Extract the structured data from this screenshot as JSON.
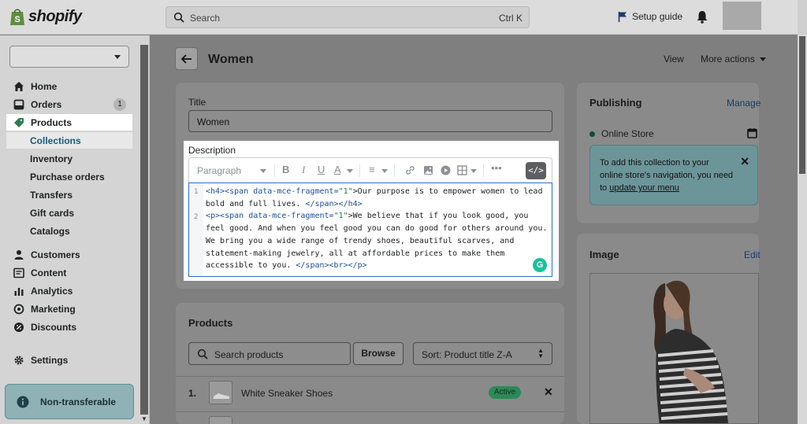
{
  "topbar": {
    "brand": "shopify",
    "search_placeholder": "Search",
    "search_shortcut": "Ctrl K",
    "setup_guide": "Setup guide"
  },
  "sidebar": {
    "store_select_value": "",
    "items": [
      {
        "label": "Home",
        "icon": "home-icon"
      },
      {
        "label": "Orders",
        "icon": "orders-icon",
        "badge": "1"
      },
      {
        "label": "Products",
        "icon": "tag-icon",
        "active": true
      },
      {
        "label": "Collections",
        "sub": true,
        "selected": true
      },
      {
        "label": "Inventory",
        "sub": true
      },
      {
        "label": "Purchase orders",
        "sub": true
      },
      {
        "label": "Transfers",
        "sub": true
      },
      {
        "label": "Gift cards",
        "sub": true
      },
      {
        "label": "Catalogs",
        "sub": true
      },
      {
        "label": "Customers",
        "icon": "person-icon"
      },
      {
        "label": "Content",
        "icon": "content-icon"
      },
      {
        "label": "Analytics",
        "icon": "analytics-icon"
      },
      {
        "label": "Marketing",
        "icon": "marketing-icon"
      },
      {
        "label": "Discounts",
        "icon": "discount-icon"
      },
      {
        "label": "Settings",
        "icon": "gear-icon"
      }
    ],
    "nontransferable": "Non-transferable"
  },
  "page": {
    "title": "Women",
    "view_label": "View",
    "more_actions_label": "More actions"
  },
  "collection_form": {
    "title_label": "Title",
    "title_value": "Women",
    "description_label": "Description",
    "paragraph_label": "Paragraph",
    "code_lines": {
      "l1_tag_open": "<h4><span ",
      "l1_attr": "data-mce-fragment=",
      "l1_val": "\"1\"",
      "l1_text": ">Our purpose is to empower women to lead bold and full lives. ",
      "l1_tag_close": "</span></h4>",
      "l2_tag_open": "<p><span ",
      "l2_attr": "data-mce-fragment=",
      "l2_val": "\"1\"",
      "l2_text": ">We believe that if you look good, you feel good. And when you feel good you can do good for others around you. We bring you a wide range of trendy shoes, beautiful scarves, and statement-making jewelry, all at affordable prices to make them accessible to you. ",
      "l2_tag_close": "</span><br></p>"
    },
    "line_numbers": [
      "1",
      "2"
    ]
  },
  "products": {
    "title": "Products",
    "search_placeholder": "Search products",
    "browse_label": "Browse",
    "sort_label": "Sort: Product title Z-A",
    "rows": [
      {
        "num": "1.",
        "name": "White Sneaker Shoes",
        "status": "Active"
      }
    ]
  },
  "publishing": {
    "title": "Publishing",
    "manage_label": "Manage",
    "channel": "Online Store",
    "banner_text": "To add this collection to your online store's navigation, you need to ",
    "banner_link": "update your menu"
  },
  "image_card": {
    "title": "Image",
    "edit_label": "Edit"
  },
  "colors": {
    "accent": "#2c6ecb",
    "active_badge": "#2b8a57",
    "grammarly": "#15c39a"
  }
}
